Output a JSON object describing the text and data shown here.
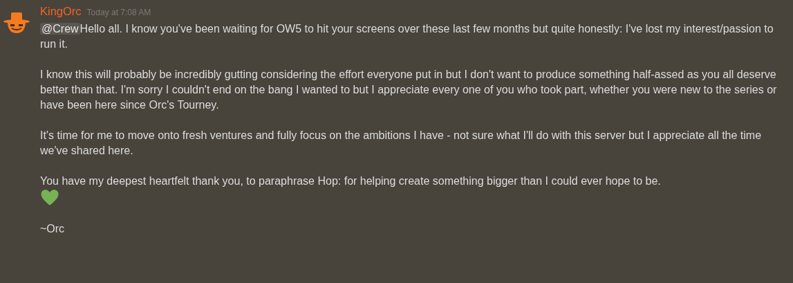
{
  "message": {
    "author": "KingOrc",
    "timestamp": "Today at 7:08 AM",
    "mention": "@Crew",
    "blocks": [
      {
        "kind": "text",
        "text": "Hello all. I know you've been waiting for OW5 to hit your screens over these last few months but quite honestly: I've lost my interest/passion to run it."
      },
      {
        "kind": "text",
        "text": "I know this will probably be incredibly gutting considering the effort everyone put in but I don't want to produce something half-assed as you all deserve better than that. I'm sorry I couldn't end on the bang I wanted to but I appreciate every one of you who took part, whether you were new to the series or have been here since Orc's Tourney."
      },
      {
        "kind": "text",
        "text": "It's time for me to move onto fresh ventures and fully focus on the ambitions I have - not sure what I'll do with this server but I appreciate all the time we've shared here."
      },
      {
        "kind": "text",
        "text": "You have my deepest heartfelt thank you, to paraphrase Hop: for helping create something bigger than I could ever hope to be."
      },
      {
        "kind": "emoji"
      },
      {
        "kind": "text",
        "text": "~Orc"
      }
    ]
  }
}
